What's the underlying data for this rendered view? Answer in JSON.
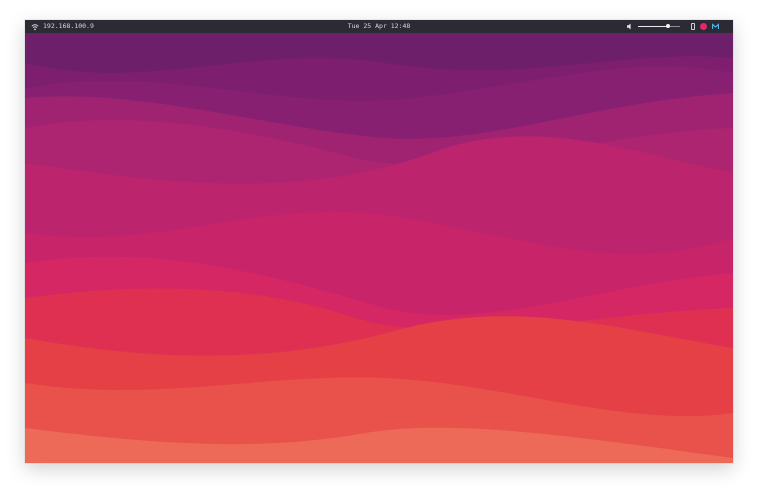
{
  "topbar": {
    "ip_address": "192.168.100.9",
    "datetime": "Tue 25 Apr 12:48",
    "volume_level": 0.72
  },
  "colors": {
    "topbar_bg": "#2c2b33",
    "wallpaper_top": "#6e1f6a",
    "wallpaper_bottom": "#ec6a57"
  },
  "icons": {
    "network": "wifi-icon",
    "volume": "speaker-icon",
    "battery": "battery-icon",
    "tray1": "app-icon",
    "tray2": "app-icon-2"
  }
}
